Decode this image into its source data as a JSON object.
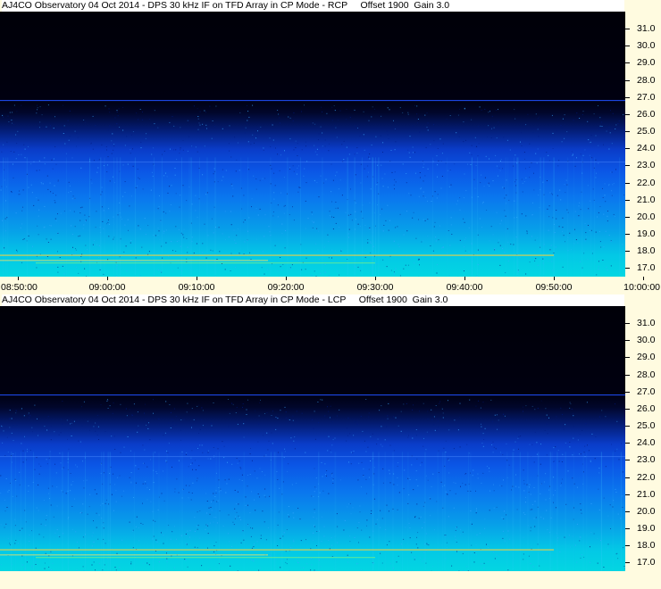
{
  "chart_data": [
    {
      "type": "heatmap",
      "title": "AJ4CO Observatory 04 Oct 2014 - DPS 30 kHz IF on TFD Array in CP Mode - RCP     Offset 1900  Gain 3.0",
      "y_ticks": [
        "31.0",
        "30.0",
        "29.0",
        "28.0",
        "27.0",
        "26.0",
        "25.0",
        "24.0",
        "23.0",
        "22.0",
        "21.0",
        "20.0",
        "19.0",
        "18.0",
        "17.0"
      ],
      "y_values": [
        31.0,
        30.0,
        29.0,
        28.0,
        27.0,
        26.0,
        25.0,
        24.0,
        23.0,
        22.0,
        21.0,
        20.0,
        19.0,
        18.0,
        17.0
      ],
      "x_ticks": [
        "08:50:00",
        "09:00:00",
        "09:10:00",
        "09:20:00",
        "09:30:00",
        "09:40:00",
        "09:50:00",
        "10:00:00"
      ],
      "x_minutes": [
        0,
        10,
        20,
        30,
        40,
        50,
        60,
        70
      ],
      "colormap": [
        "#000008",
        "#031a6e",
        "#0a3cc8",
        "#0a76ee",
        "#03d6e2"
      ]
    },
    {
      "type": "heatmap",
      "title": "AJ4CO Observatory 04 Oct 2014 - DPS 30 kHz IF on TFD Array in CP Mode - LCP     Offset 1900  Gain 3.0",
      "y_ticks": [
        "31.0",
        "30.0",
        "29.0",
        "28.0",
        "27.0",
        "26.0",
        "25.0",
        "24.0",
        "23.0",
        "22.0",
        "21.0",
        "20.0",
        "19.0",
        "18.0",
        "17.0"
      ],
      "y_values": [
        31.0,
        30.0,
        29.0,
        28.0,
        27.0,
        26.0,
        25.0,
        24.0,
        23.0,
        22.0,
        21.0,
        20.0,
        19.0,
        18.0,
        17.0
      ],
      "x_ticks": [],
      "x_minutes": [],
      "colormap": [
        "#000008",
        "#031a6e",
        "#0a3cc8",
        "#0a76ee",
        "#03d6e2"
      ]
    }
  ]
}
